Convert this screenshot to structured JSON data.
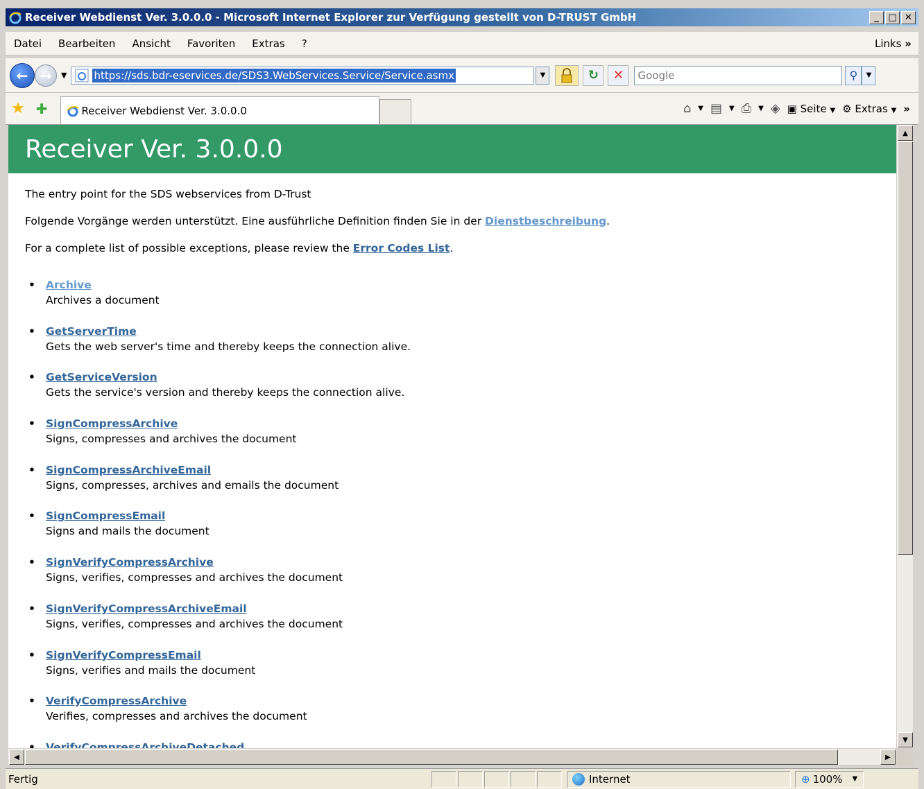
{
  "window": {
    "title": "Receiver Webdienst Ver. 3.0.0.0 - Microsoft Internet Explorer  zur Verfügung gestellt von D-TRUST GmbH",
    "minimize": "_",
    "maximize": "□",
    "close": "✕"
  },
  "menu": {
    "items": [
      "Datei",
      "Bearbeiten",
      "Ansicht",
      "Favoriten",
      "Extras",
      "?"
    ],
    "links": "Links",
    "chevron": "»"
  },
  "address": {
    "url": "https://sds.bdr-eservices.de/SDS3.WebServices.Service/Service.asmx",
    "search_placeholder": "Google"
  },
  "tab": {
    "title": "Receiver Webdienst Ver. 3.0.0.0"
  },
  "commandbar": {
    "page": "Seite",
    "tools": "Extras",
    "chevron": "»"
  },
  "page": {
    "heading": "Receiver Ver. 3.0.0.0",
    "intro1": "The entry point for the SDS webservices from D-Trust",
    "intro2_prefix": "Folgende Vorgänge werden unterstützt. Eine ausführliche Definition finden Sie in der ",
    "intro2_link": "Dienstbeschreibung",
    "intro2_suffix": ".",
    "intro3_prefix": "For a complete list of possible exceptions, please review the ",
    "intro3_link": "Error Codes List",
    "intro3_suffix": ".",
    "operations": [
      {
        "name": "Archive",
        "desc": "Archives a document"
      },
      {
        "name": "GetServerTime",
        "desc": "Gets the web server's time and thereby keeps the connection alive."
      },
      {
        "name": "GetServiceVersion",
        "desc": "Gets the service's version and thereby keeps the connection alive."
      },
      {
        "name": "SignCompressArchive",
        "desc": "Signs, compresses and archives the document"
      },
      {
        "name": "SignCompressArchiveEmail",
        "desc": "Signs, compresses, archives and emails the document"
      },
      {
        "name": "SignCompressEmail",
        "desc": "Signs and mails the document"
      },
      {
        "name": "SignVerifyCompressArchive",
        "desc": "Signs, verifies, compresses and archives the document"
      },
      {
        "name": "SignVerifyCompressArchiveEmail",
        "desc": "Signs, verifies, compresses and archives the document"
      },
      {
        "name": "SignVerifyCompressEmail",
        "desc": "Signs, verifies and mails the document"
      },
      {
        "name": "VerifyCompressArchive",
        "desc": "Verifies, compresses and archives the document"
      },
      {
        "name": "VerifyCompressArchiveDetached",
        "desc": ""
      }
    ]
  },
  "status": {
    "text": "Fertig",
    "zone": "Internet",
    "zoom": "100%"
  }
}
